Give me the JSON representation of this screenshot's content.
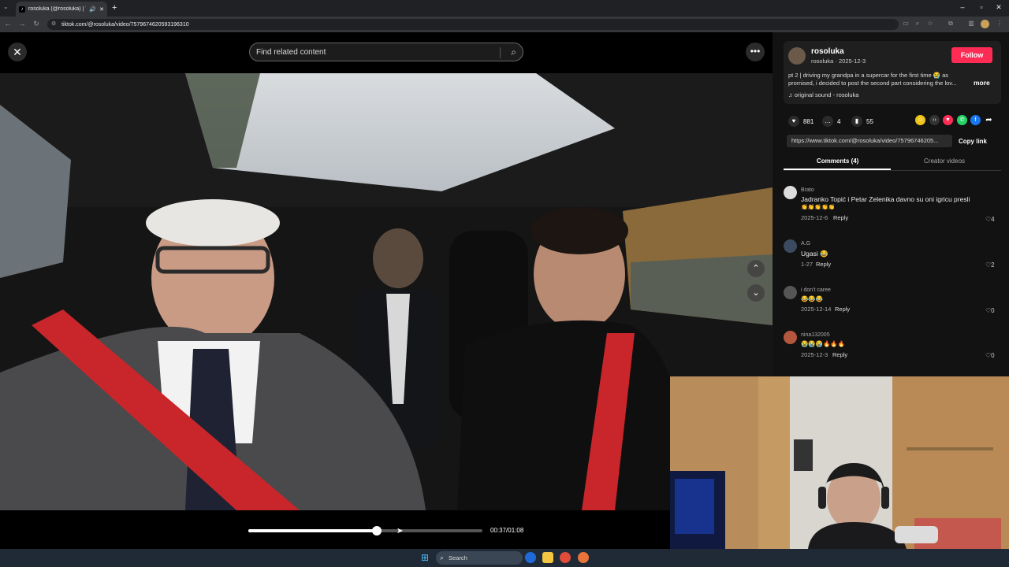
{
  "browser": {
    "tab_title": "rosoluka (@rosoluka) | TikTok",
    "tab_favicon": "tiktok-icon",
    "url": "tiktok.com/@rosoluka/video/7579674620593196310",
    "new_tab": "+",
    "close_tab": "✕"
  },
  "top": {
    "search_placeholder": "Find related content",
    "close_label": "✕",
    "more_label": "•••"
  },
  "player": {
    "time": "00:37/01:08",
    "progress": 0.55
  },
  "author": {
    "name": "rosoluka",
    "sub": "rosoluka · 2025-12-3",
    "follow": "Follow",
    "description": "pt 2 | driving my grandpa in a supercar for the first time 😭 as promised, i decided to post the second part considering the lov...",
    "more": "more",
    "sound": "original sound - rosoluka"
  },
  "stats": {
    "likes": "881",
    "comments": "4",
    "saves": "55"
  },
  "share": {
    "link": "https://www.tiktok.com/@rosoluka/video/75796746205...",
    "copy": "Copy link"
  },
  "tabs": {
    "comments": "Comments (4)",
    "creator": "Creator videos"
  },
  "comments": [
    {
      "user": "Brato",
      "text": "Jadranko Topić i Petar Zelenika davno su oni igricu presli",
      "emoji": "👏👏👏👏👏",
      "date": "2025-12-6",
      "reply": "Reply",
      "likes": "4"
    },
    {
      "user": "A.G",
      "text": "Ugasi 😂",
      "emoji": "",
      "date": "1-27",
      "reply": "Reply",
      "likes": "2"
    },
    {
      "user": "i don't caree",
      "text": "😂😂😂",
      "emoji": "",
      "date": "2025-12-14",
      "reply": "Reply",
      "likes": "0"
    },
    {
      "user": "nina132005",
      "text": "😭😭😭🔥🔥🔥",
      "emoji": "",
      "date": "2025-12-3",
      "reply": "Reply",
      "likes": "0"
    }
  ],
  "taskbar": {
    "search": "Search"
  },
  "colors": {
    "follow": "#fe2c55",
    "panel": "#121212"
  }
}
